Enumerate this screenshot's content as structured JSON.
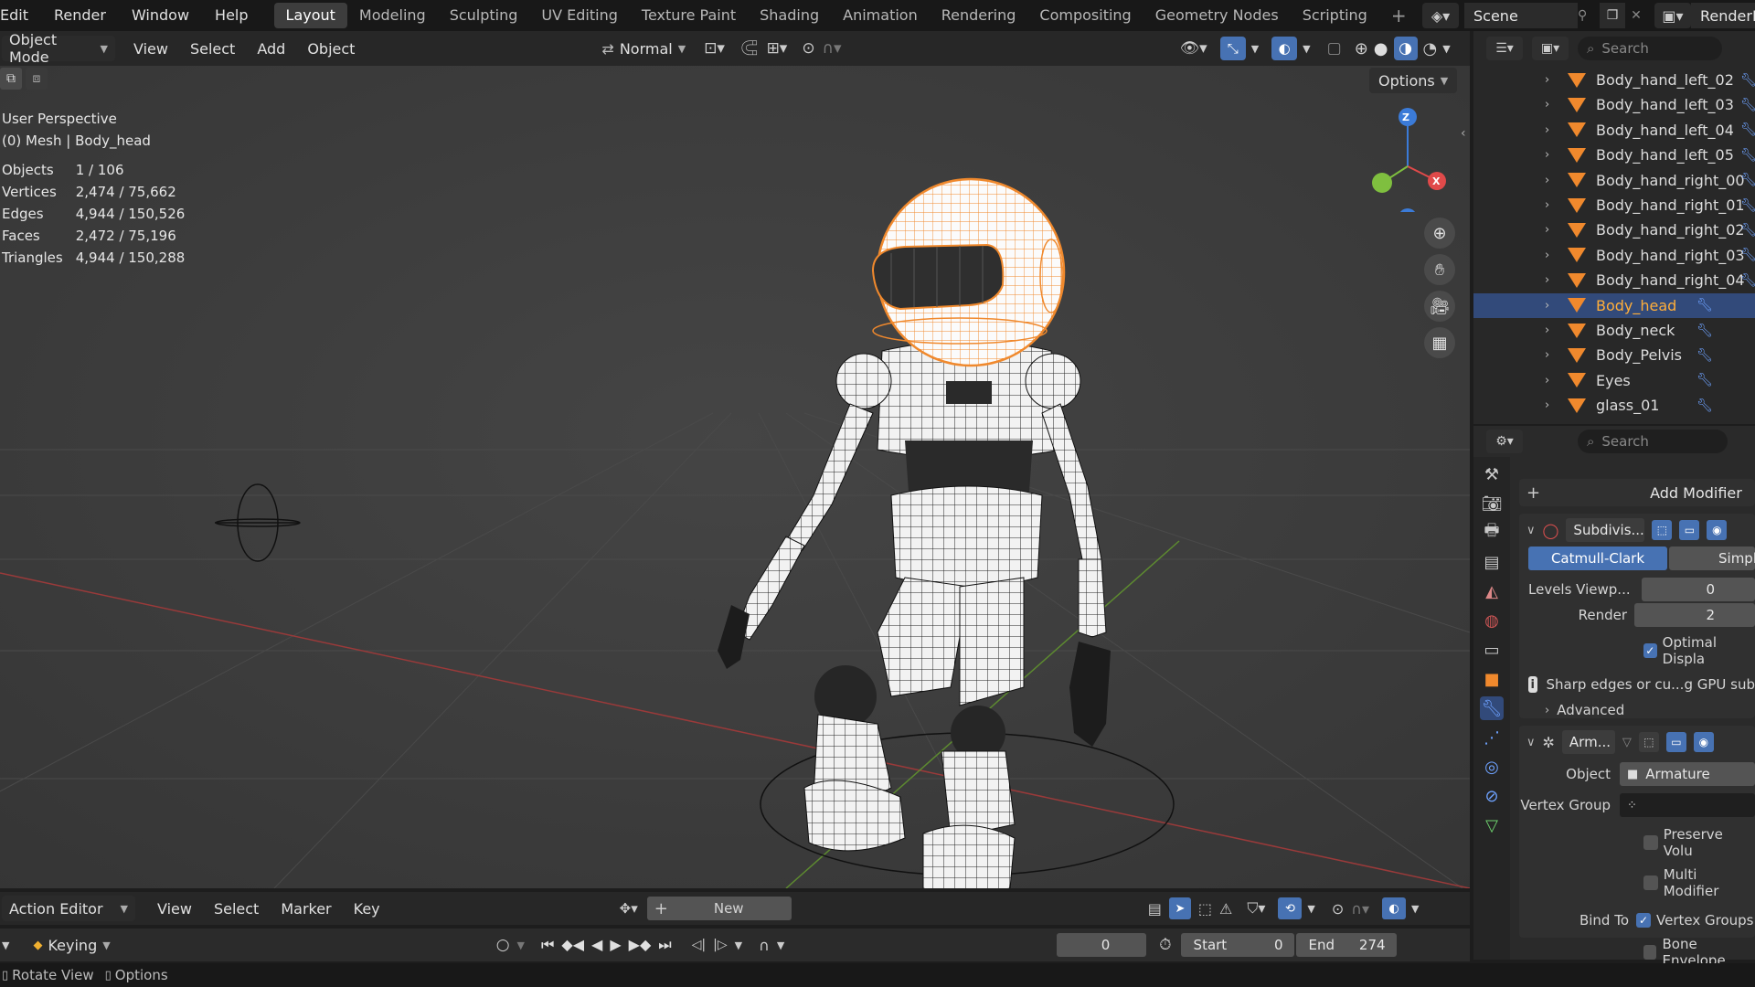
{
  "topbar": {
    "menus": [
      "Edit",
      "Render",
      "Window",
      "Help"
    ],
    "workspaces": [
      "Layout",
      "Modeling",
      "Sculpting",
      "UV Editing",
      "Texture Paint",
      "Shading",
      "Animation",
      "Rendering",
      "Compositing",
      "Geometry Nodes",
      "Scripting"
    ],
    "active_workspace": "Layout",
    "scene_label": "Scene",
    "view_layer_label": "RenderLa"
  },
  "viewport_header": {
    "mode": "Object Mode",
    "menus": [
      "View",
      "Select",
      "Add",
      "Object"
    ],
    "orientation": "Normal",
    "options_label": "Options"
  },
  "viewport": {
    "perspective": "User Perspective",
    "object_info": "(0) Mesh | Body_head",
    "stats": [
      {
        "label": "Objects",
        "value": "1 / 106"
      },
      {
        "label": "Vertices",
        "value": "2,474 / 75,662"
      },
      {
        "label": "Edges",
        "value": "4,944 / 150,526"
      },
      {
        "label": "Faces",
        "value": "2,472 / 75,196"
      },
      {
        "label": "Triangles",
        "value": "4,944 / 150,288"
      }
    ],
    "gizmo_axes": [
      "Z",
      "X"
    ],
    "colors": {
      "x_axis": "#e04a4a",
      "y_axis": "#7fbf3f",
      "z_axis": "#3b7bd8",
      "selected": "#f0892d"
    }
  },
  "outliner": {
    "search_placeholder": "Search",
    "items": [
      {
        "name": "Body_hand_left_02",
        "selected": false
      },
      {
        "name": "Body_hand_left_03",
        "selected": false
      },
      {
        "name": "Body_hand_left_04",
        "selected": false
      },
      {
        "name": "Body_hand_left_05",
        "selected": false
      },
      {
        "name": "Body_hand_right_00",
        "selected": false
      },
      {
        "name": "Body_hand_right_01",
        "selected": false
      },
      {
        "name": "Body_hand_right_02",
        "selected": false
      },
      {
        "name": "Body_hand_right_03",
        "selected": false
      },
      {
        "name": "Body_hand_right_04",
        "selected": false
      },
      {
        "name": "Body_head",
        "selected": true
      },
      {
        "name": "Body_neck",
        "selected": false
      },
      {
        "name": "Body_Pelvis",
        "selected": false
      },
      {
        "name": "Eyes",
        "selected": false
      },
      {
        "name": "glass_01",
        "selected": false
      }
    ]
  },
  "properties": {
    "search_placeholder": "Search",
    "add_modifier": "Add Modifier",
    "subdivision": {
      "name": "Subdivis...",
      "catmull": "Catmull-Clark",
      "simple": "Simpl",
      "levels_label": "Levels Viewp...",
      "levels_value": "0",
      "render_label": "Render",
      "render_value": "2",
      "optimal": "Optimal Displa",
      "warning": "Sharp edges or cu...g GPU sub",
      "advanced": "Advanced"
    },
    "armature": {
      "name": "Arm...",
      "object_label": "Object",
      "object_value": "Armature",
      "vgroup_label": "Vertex Group",
      "preserve": "Preserve Volu",
      "multi": "Multi Modifier",
      "bind_label": "Bind To",
      "vertex_groups": "Vertex Groups",
      "bone_env": "Bone Envelope"
    }
  },
  "timeline": {
    "editor": "Action Editor",
    "menus": [
      "View",
      "Select",
      "Marker",
      "Key"
    ],
    "new_label": "New",
    "keying": "Keying",
    "current_frame": "0",
    "start_label": "Start",
    "start_value": "0",
    "end_label": "End",
    "end_value": "274"
  },
  "status": {
    "rotate": "Rotate View",
    "options": "Options"
  }
}
